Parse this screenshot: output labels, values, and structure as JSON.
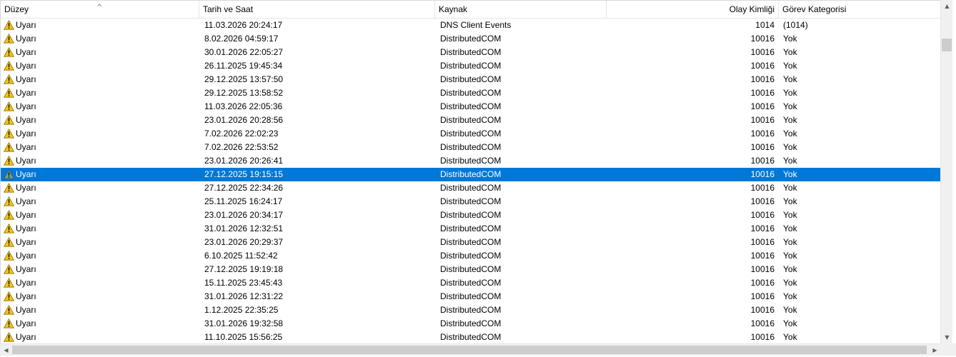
{
  "columns": {
    "level": "Düzey",
    "date": "Tarih ve Saat",
    "source": "Kaynak",
    "event_id": "Olay Kimliği",
    "category": "Görev Kategorisi"
  },
  "sort_indicator": "^",
  "icons": {
    "warning": "warning-icon",
    "scroll_up": "▲",
    "scroll_down": "▼",
    "scroll_left": "◀",
    "scroll_right": "▶"
  },
  "colors": {
    "selection": "#0078d7",
    "warning_yellow": "#f5c518",
    "scrollbar_thumb": "#cdcdcd"
  },
  "rows": [
    {
      "level": "Uyarı",
      "date": "11.03.2026 20:24:17",
      "source": "DNS Client Events",
      "event_id": "1014",
      "category": "(1014)"
    },
    {
      "level": "Uyarı",
      "date": "8.02.2026 04:59:17",
      "source": "DistributedCOM",
      "event_id": "10016",
      "category": "Yok"
    },
    {
      "level": "Uyarı",
      "date": "30.01.2026 22:05:27",
      "source": "DistributedCOM",
      "event_id": "10016",
      "category": "Yok"
    },
    {
      "level": "Uyarı",
      "date": "26.11.2025 19:45:34",
      "source": "DistributedCOM",
      "event_id": "10016",
      "category": "Yok"
    },
    {
      "level": "Uyarı",
      "date": "29.12.2025 13:57:50",
      "source": "DistributedCOM",
      "event_id": "10016",
      "category": "Yok"
    },
    {
      "level": "Uyarı",
      "date": "29.12.2025 13:58:52",
      "source": "DistributedCOM",
      "event_id": "10016",
      "category": "Yok"
    },
    {
      "level": "Uyarı",
      "date": "11.03.2026 22:05:36",
      "source": "DistributedCOM",
      "event_id": "10016",
      "category": "Yok"
    },
    {
      "level": "Uyarı",
      "date": "23.01.2026 20:28:56",
      "source": "DistributedCOM",
      "event_id": "10016",
      "category": "Yok"
    },
    {
      "level": "Uyarı",
      "date": "7.02.2026 22:02:23",
      "source": "DistributedCOM",
      "event_id": "10016",
      "category": "Yok"
    },
    {
      "level": "Uyarı",
      "date": "7.02.2026 22:53:52",
      "source": "DistributedCOM",
      "event_id": "10016",
      "category": "Yok"
    },
    {
      "level": "Uyarı",
      "date": "23.01.2026 20:26:41",
      "source": "DistributedCOM",
      "event_id": "10016",
      "category": "Yok"
    },
    {
      "level": "Uyarı",
      "date": "27.12.2025 19:15:15",
      "source": "DistributedCOM",
      "event_id": "10016",
      "category": "Yok",
      "selected": true
    },
    {
      "level": "Uyarı",
      "date": "27.12.2025 22:34:26",
      "source": "DistributedCOM",
      "event_id": "10016",
      "category": "Yok"
    },
    {
      "level": "Uyarı",
      "date": "25.11.2025 16:24:17",
      "source": "DistributedCOM",
      "event_id": "10016",
      "category": "Yok"
    },
    {
      "level": "Uyarı",
      "date": "23.01.2026 20:34:17",
      "source": "DistributedCOM",
      "event_id": "10016",
      "category": "Yok"
    },
    {
      "level": "Uyarı",
      "date": "31.01.2026 12:32:51",
      "source": "DistributedCOM",
      "event_id": "10016",
      "category": "Yok"
    },
    {
      "level": "Uyarı",
      "date": "23.01.2026 20:29:37",
      "source": "DistributedCOM",
      "event_id": "10016",
      "category": "Yok"
    },
    {
      "level": "Uyarı",
      "date": "6.10.2025 11:52:42",
      "source": "DistributedCOM",
      "event_id": "10016",
      "category": "Yok"
    },
    {
      "level": "Uyarı",
      "date": "27.12.2025 19:19:18",
      "source": "DistributedCOM",
      "event_id": "10016",
      "category": "Yok"
    },
    {
      "level": "Uyarı",
      "date": "15.11.2025 23:45:43",
      "source": "DistributedCOM",
      "event_id": "10016",
      "category": "Yok"
    },
    {
      "level": "Uyarı",
      "date": "31.01.2026 12:31:22",
      "source": "DistributedCOM",
      "event_id": "10016",
      "category": "Yok"
    },
    {
      "level": "Uyarı",
      "date": "1.12.2025 22:35:25",
      "source": "DistributedCOM",
      "event_id": "10016",
      "category": "Yok"
    },
    {
      "level": "Uyarı",
      "date": "31.01.2026 19:32:58",
      "source": "DistributedCOM",
      "event_id": "10016",
      "category": "Yok"
    },
    {
      "level": "Uyarı",
      "date": "11.10.2025 15:56:25",
      "source": "DistributedCOM",
      "event_id": "10016",
      "category": "Yok"
    }
  ]
}
